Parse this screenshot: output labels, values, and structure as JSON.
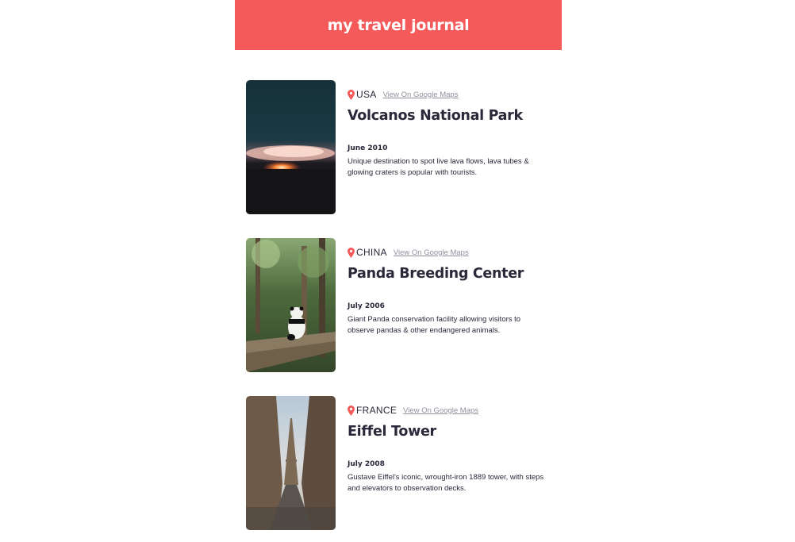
{
  "header": {
    "title": "my travel journal"
  },
  "entries": [
    {
      "country": "USA",
      "maps_link": "View On Google Maps",
      "place": "Volcanos National Park",
      "date": "June 2010",
      "description": "Unique destination to spot live lava flows, lava tubes & glowing craters is popular with tourists."
    },
    {
      "country": "CHINA",
      "maps_link": "View On Google Maps",
      "place": "Panda Breeding Center",
      "date": "July 2006",
      "description": "Giant Panda conservation facility allowing visitors to observe pandas & other endangered animals."
    },
    {
      "country": "FRANCE",
      "maps_link": "View On Google Maps",
      "place": "Eiffel Tower",
      "date": "July 2008",
      "description": "Gustave Eiffel's iconic, wrought-iron 1889 tower, with steps and elevators to observation decks."
    }
  ],
  "colors": {
    "header_bg": "#F55A5A",
    "text": "#2B283A",
    "link": "#918E9B"
  },
  "icons": {
    "location": "map-pin-icon"
  }
}
